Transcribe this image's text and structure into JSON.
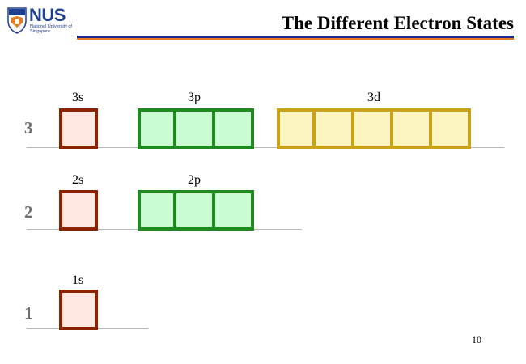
{
  "header": {
    "logo_text": "NUS",
    "logo_subtext": "National University of Singapore",
    "title": "The Different Electron States"
  },
  "levels": [
    {
      "number": "3",
      "subshells": [
        {
          "label": "3s",
          "type": "s",
          "orbitals": 1
        },
        {
          "label": "3p",
          "type": "p",
          "orbitals": 3
        },
        {
          "label": "3d",
          "type": "d",
          "orbitals": 5
        }
      ]
    },
    {
      "number": "2",
      "subshells": [
        {
          "label": "2s",
          "type": "s",
          "orbitals": 1
        },
        {
          "label": "2p",
          "type": "p",
          "orbitals": 3
        }
      ]
    },
    {
      "number": "1",
      "subshells": [
        {
          "label": "1s",
          "type": "s",
          "orbitals": 1
        }
      ]
    }
  ],
  "colors": {
    "s_border": "#8b2200",
    "s_fill": "#ffe8e2",
    "p_border": "#1f8a1f",
    "p_fill": "#c9fcd0",
    "d_border": "#c8a31a",
    "d_fill": "#fdf5c0",
    "title_rule": "#1e2a8f",
    "accent_rule": "#e87a1e"
  },
  "footer": {
    "page_number": "10"
  }
}
